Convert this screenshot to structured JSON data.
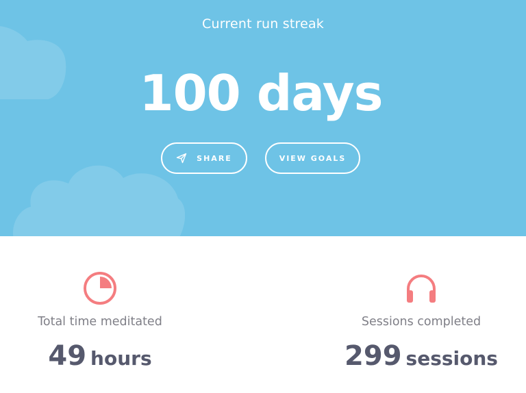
{
  "hero": {
    "subtitle": "Current run streak",
    "value": "100 days",
    "background_color": "#6ec3e6",
    "buttons": {
      "share": {
        "label": "SHARE",
        "icon": "send-icon"
      },
      "goals": {
        "label": "VIEW GOALS"
      }
    }
  },
  "stats": [
    {
      "icon": "pie-chart-icon",
      "label": "Total time meditated",
      "number": "49",
      "unit": "hours",
      "icon_color": "#f47d80"
    },
    {
      "icon": "headphones-icon",
      "label": "Sessions completed",
      "number": "299",
      "unit": "sessions",
      "icon_color": "#f47d80"
    }
  ]
}
